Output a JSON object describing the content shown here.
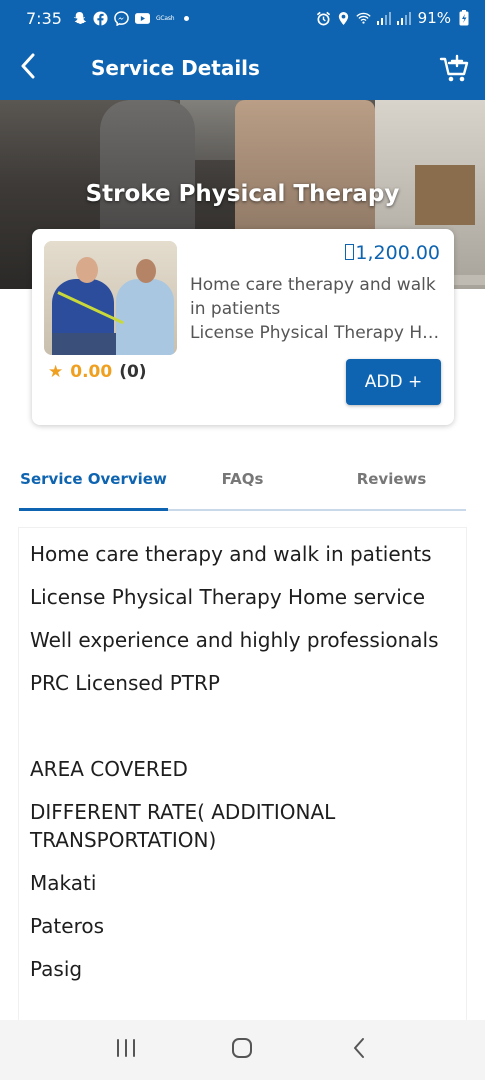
{
  "status_bar": {
    "time": "7:35",
    "left_icons": [
      "snapchat-icon",
      "facebook-icon",
      "messenger-icon",
      "youtube-icon",
      "gcash-icon",
      "dot-icon"
    ],
    "gcash_text": "GCash",
    "right_icons": [
      "alarm-icon",
      "location-icon",
      "wifi-icon",
      "signal-icon",
      "signal-icon",
      "battery-charging-icon"
    ],
    "battery": "91%"
  },
  "app_bar": {
    "title": "Service Details",
    "back_icon": "chevron-left-icon",
    "cart_icon": "cart-plus-icon"
  },
  "hero": {
    "title": "Stroke Physical Therapy"
  },
  "service_card": {
    "price": "1,200.00",
    "currency_symbol_note": "missing-glyph-box",
    "description": "Home care therapy and walk in patients",
    "subtitle": "License Physical Therapy Home service",
    "rating": "0.00",
    "rating_count": "(0)",
    "add_button": "ADD +"
  },
  "tabs": [
    {
      "label": "Service Overview",
      "active": true
    },
    {
      "label": "FAQs",
      "active": false
    },
    {
      "label": "Reviews",
      "active": false
    }
  ],
  "content_lines": [
    "Home care therapy and walk in patients",
    "License Physical Therapy Home service",
    "Well experience and highly professionals",
    "PRC Licensed PTRP",
    "",
    "AREA COVERED",
    "DIFFERENT RATE( ADDITIONAL TRANSPORTATION)",
    "Makati",
    "Pateros",
    "Pasig"
  ],
  "colors": {
    "primary": "#0e64b0",
    "star": "#f0a020",
    "text": "#1e1e1e"
  },
  "nav_bar": {
    "icons": [
      "recent-apps-icon",
      "home-icon",
      "back-icon"
    ]
  }
}
